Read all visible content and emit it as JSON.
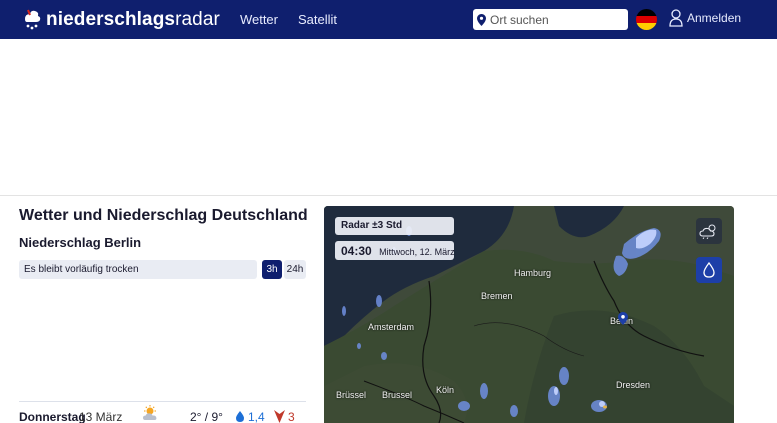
{
  "header": {
    "logo_part1": "niederschlags",
    "logo_part2": "radar",
    "nav": [
      {
        "label": "Wetter"
      },
      {
        "label": "Satellit"
      }
    ],
    "search_placeholder": "Ort suchen",
    "login_label": "Anmelden",
    "colors": {
      "bar": "#0f1f6e",
      "flag": [
        "#000000",
        "#dd0000",
        "#ffce00"
      ]
    }
  },
  "main": {
    "title": "Wetter und Niederschlag Deutschland",
    "section_title": "Niederschlag Berlin",
    "status_text": "Es bleibt vorläufig trocken",
    "toggle": {
      "options": [
        "3h",
        "24h"
      ],
      "selected": "3h"
    }
  },
  "forecast": [
    {
      "day": "Donnerstag",
      "date": "13 März",
      "icon": "partly-cloudy-sun-icon",
      "temp": "2° / 9°",
      "rain": "1,4",
      "wind": "3"
    }
  ],
  "map": {
    "radar_label": "Radar ±3 Std",
    "time": "04:30",
    "date": "Mittwoch, 12. März",
    "cities": [
      {
        "name": "Hamburg"
      },
      {
        "name": "Bremen"
      },
      {
        "name": "Berlin"
      },
      {
        "name": "Amsterdam"
      },
      {
        "name": "Köln"
      },
      {
        "name": "Dresden"
      },
      {
        "name": "Brüssel"
      },
      {
        "name": "Brussel"
      }
    ],
    "buttons": [
      "cloud-sun-icon",
      "raindrop-icon"
    ]
  }
}
